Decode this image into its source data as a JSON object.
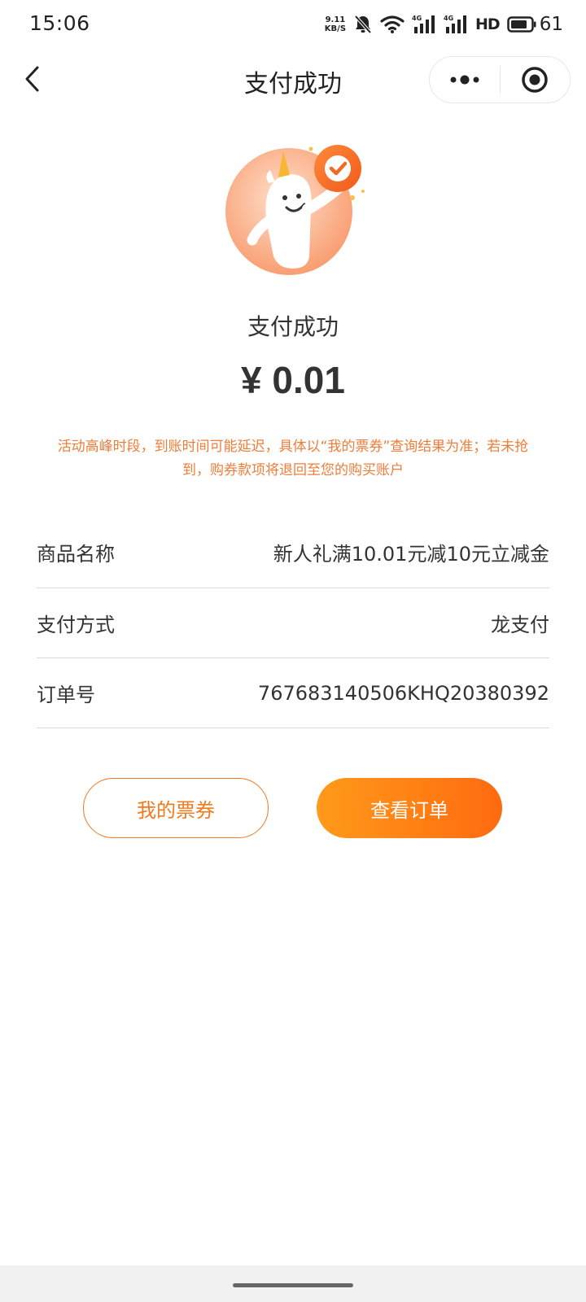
{
  "status_bar": {
    "time": "15:06",
    "net_speed_value": "9.11",
    "net_speed_unit": "KB/S",
    "network_label": "4G",
    "hd_label": "HD",
    "battery_level": "61"
  },
  "nav": {
    "title": "支付成功"
  },
  "result": {
    "title": "支付成功",
    "amount": "¥ 0.01",
    "notice": "活动高峰时段，到账时间可能延迟，具体以“我的票券”查询结果为准；若未抢到，购券款项将退回至您的购买账户"
  },
  "details": [
    {
      "label": "商品名称",
      "value": "新人礼满10.01元减10元立减金"
    },
    {
      "label": "支付方式",
      "value": "龙支付"
    },
    {
      "label": "订单号",
      "value": "767683140506KHQ20380392"
    }
  ],
  "buttons": {
    "my_tickets": "我的票券",
    "view_order": "查看订单"
  },
  "colors": {
    "accent": "#f07a1e",
    "accent_gradient_start": "#ff9a1a",
    "accent_gradient_end": "#ff6a10",
    "notice_text": "#ee7d3a"
  },
  "icons": {
    "back": "chevron-left-icon",
    "more": "more-dots-icon",
    "close": "target-circle-icon",
    "success": "check-circle-icon",
    "mascot": "unicorn-mascot-icon"
  }
}
